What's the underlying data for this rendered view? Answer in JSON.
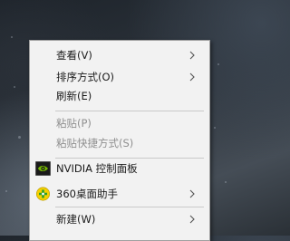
{
  "menu": {
    "items": [
      {
        "label": "查看(V)",
        "has_submenu": true,
        "enabled": true
      },
      {
        "label": "排序方式(O)",
        "has_submenu": true,
        "enabled": true
      },
      {
        "label": "刷新(E)",
        "has_submenu": false,
        "enabled": true
      },
      {
        "label": "粘贴(P)",
        "has_submenu": false,
        "enabled": false
      },
      {
        "label": "粘贴快捷方式(S)",
        "has_submenu": false,
        "enabled": false
      },
      {
        "label": "NVIDIA 控制面板",
        "has_submenu": false,
        "enabled": true,
        "icon": "nvidia-icon"
      },
      {
        "label": "360桌面助手",
        "has_submenu": true,
        "enabled": true,
        "icon": "360-assistant-icon"
      },
      {
        "label": "新建(W)",
        "has_submenu": true,
        "enabled": true
      }
    ]
  },
  "colors": {
    "menu_background": "#f2f2f2",
    "disabled_text": "#8f8f8f",
    "nvidia_green": "#76b900",
    "assistant_yellow": "#f5d000"
  }
}
